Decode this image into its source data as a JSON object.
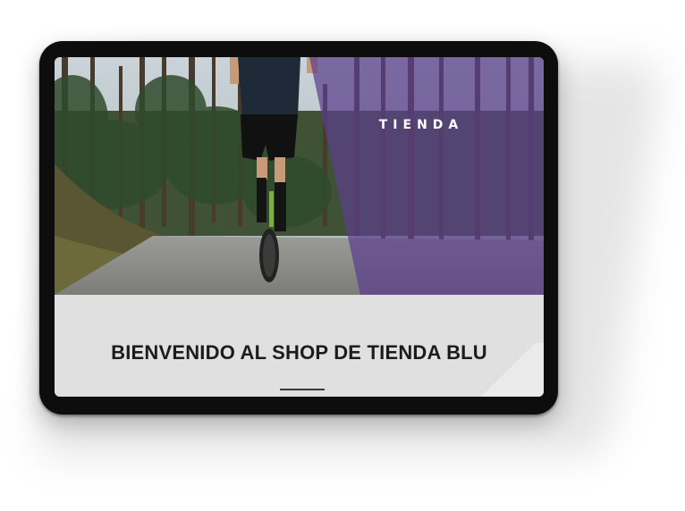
{
  "hero": {
    "title": "TIENDA"
  },
  "main": {
    "headline": "BIENVENIDO AL SHOP DE TIENDA BLU"
  },
  "colors": {
    "overlay_purple": "#5b3f8c",
    "background": "#e0e0e0",
    "headline_text": "#1c1c1c"
  }
}
